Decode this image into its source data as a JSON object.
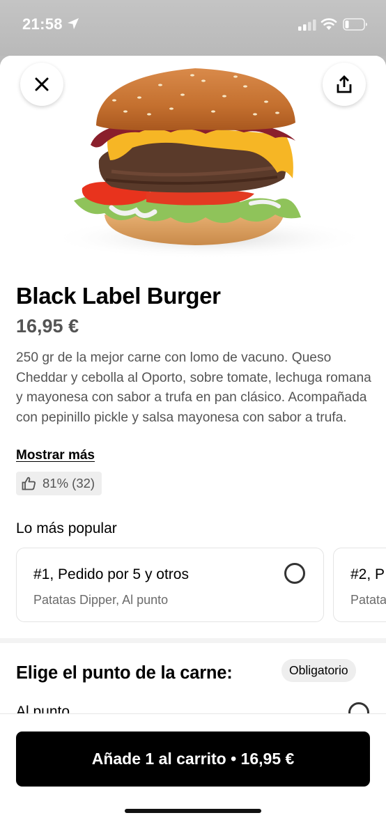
{
  "status_bar": {
    "time": "21:58",
    "icons": [
      "location-arrow-icon",
      "cellular-signal-icon",
      "wifi-icon",
      "battery-icon"
    ]
  },
  "toolbar": {
    "close_icon": "close-icon",
    "share_icon": "share-icon"
  },
  "product": {
    "image": "burger-photo",
    "name": "Black Label Burger",
    "price": "16,95 €",
    "description": "250 gr de la mejor carne con lomo de vacuno. Queso Cheddar y cebolla al Oporto, sobre tomate, lechuga romana y mayonesa con sabor a trufa en pan clásico. Acompañada con pepinillo pickle y salsa mayonesa con sabor a trufa.",
    "show_more": "Mostrar más",
    "rating": "81% (32)"
  },
  "popular": {
    "title": "Lo más popular",
    "cards": [
      {
        "title": "#1, Pedido por 5 y otros",
        "subtitle": "Patatas Dipper, Al punto"
      },
      {
        "title": "#2, P",
        "subtitle": "Patata"
      }
    ]
  },
  "choice": {
    "title": "Elige el punto de la carne:",
    "badge": "Obligatorio",
    "first_option": "Al punto"
  },
  "cart_button": {
    "label": "Añade 1 al carrito • 16,95 €"
  },
  "colors": {
    "primary": "#000000",
    "secondary_text": "#545454",
    "muted_text": "#6b6b6b",
    "chip_bg": "#eeeeee",
    "status_bar_bg": "#bcbcbc"
  }
}
